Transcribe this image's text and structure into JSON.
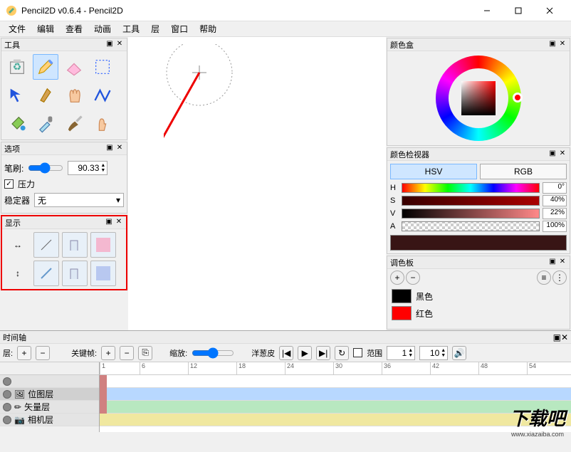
{
  "window": {
    "title": "Pencil2D v0.6.4 - Pencil2D"
  },
  "menu": {
    "file": "文件",
    "edit": "编辑",
    "view": "查看",
    "anim": "动画",
    "tools": "工具",
    "layer": "层",
    "window": "窗口",
    "help": "帮助"
  },
  "panels": {
    "tools": {
      "title": "工具"
    },
    "options": {
      "title": "选项",
      "brush_label": "笔刷:",
      "brush_value": "90.33",
      "pressure": "压力",
      "stabilizer_label": "稳定器",
      "stabilizer_value": "无"
    },
    "display": {
      "title": "显示"
    },
    "colorbox": {
      "title": "颜色盒"
    },
    "colorinspector": {
      "title": "颜色检视器",
      "hsv": "HSV",
      "rgb": "RGB",
      "h": "H",
      "s": "S",
      "v": "V",
      "a": "A",
      "h_val": "0°",
      "s_val": "40%",
      "v_val": "22%",
      "a_val": "100%"
    },
    "palette": {
      "title": "调色板",
      "items": [
        {
          "name": "黑色",
          "color": "#000000"
        },
        {
          "name": "红色",
          "color": "#ff0000"
        }
      ]
    },
    "timeline": {
      "title": "时间轴",
      "layers_label": "层:",
      "keyframe_label": "关键帧:",
      "zoom_label": "缩放:",
      "onion_label": "洋葱皮",
      "range_label": "范围",
      "range_from": "1",
      "range_to": "10",
      "layers": [
        {
          "name": "位图层"
        },
        {
          "name": "矢量层"
        },
        {
          "name": "相机层"
        }
      ],
      "ticks": [
        "1",
        "6",
        "12",
        "18",
        "24",
        "30",
        "36",
        "42",
        "48",
        "54"
      ]
    }
  },
  "watermark": {
    "main": "下载吧",
    "sub": "www.xiazaiba.com"
  }
}
